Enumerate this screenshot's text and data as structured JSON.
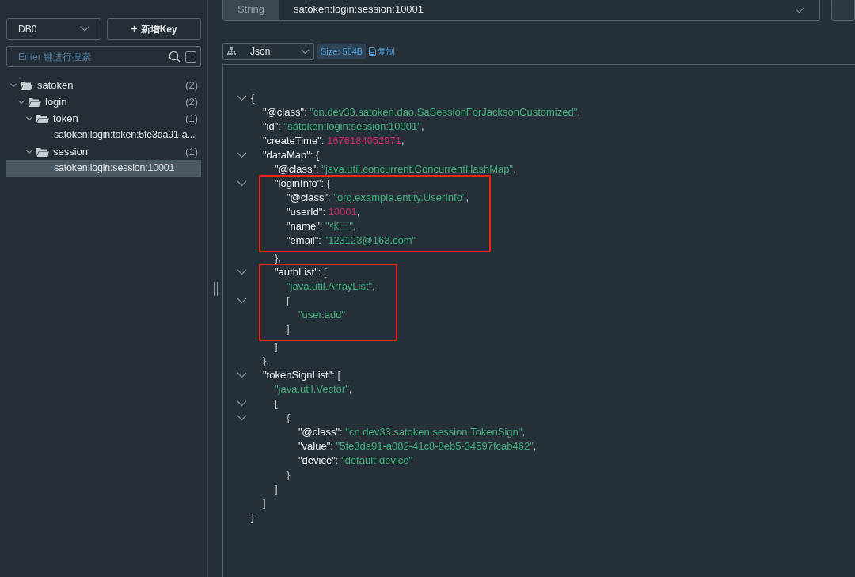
{
  "sidebar": {
    "db_select": {
      "value": "DB0"
    },
    "new_key_button": {
      "icon": "+",
      "label": "新增Key"
    },
    "search": {
      "placeholder": "Enter 键进行搜索",
      "exact_match_checked": false
    },
    "tree": [
      {
        "label": "satoken",
        "count": "(2)",
        "expanded": true,
        "selected": false,
        "children": [
          {
            "label": "login",
            "count": "(2)",
            "expanded": true,
            "selected": false,
            "children": [
              {
                "label": "token",
                "count": "(1)",
                "expanded": true,
                "selected": false,
                "children": [
                  {
                    "label": "satoken:login:token:5fe3da91-a...",
                    "selected": false
                  }
                ]
              },
              {
                "label": "session",
                "count": "(1)",
                "expanded": true,
                "selected": false,
                "children": [
                  {
                    "label": "satoken:login:session:10001",
                    "selected": true
                  }
                ]
              }
            ]
          }
        ]
      }
    ]
  },
  "key_bar": {
    "type": "String",
    "key": "satoken:login:session:10001"
  },
  "viewer": {
    "format": "Json",
    "size": "Size: 504B",
    "copy_label": "复制",
    "document": {
      "open": [
        {
          "kind": "punct",
          "text": "{"
        }
      ],
      "expanded": true,
      "close": [
        {
          "kind": "punct",
          "text": "}"
        }
      ],
      "children": [
        {
          "parts": [
            {
              "kind": "key",
              "text": "\"@class\""
            },
            {
              "kind": "punct",
              "text": ": "
            },
            {
              "kind": "string",
              "text": "\"cn.dev33.satoken.dao.SaSessionForJacksonCustomized\""
            },
            {
              "kind": "punct",
              "text": ","
            }
          ]
        },
        {
          "parts": [
            {
              "kind": "key",
              "text": "\"id\""
            },
            {
              "kind": "punct",
              "text": ": "
            },
            {
              "kind": "string",
              "text": "\"satoken:login:session:10001\""
            },
            {
              "kind": "punct",
              "text": ","
            }
          ]
        },
        {
          "parts": [
            {
              "kind": "key",
              "text": "\"createTime\""
            },
            {
              "kind": "punct",
              "text": ": "
            },
            {
              "kind": "number",
              "text": "1676184052971"
            },
            {
              "kind": "punct",
              "text": ","
            }
          ]
        },
        {
          "open": [
            {
              "kind": "key",
              "text": "\"dataMap\""
            },
            {
              "kind": "punct",
              "text": ": {"
            }
          ],
          "expanded": true,
          "close": [
            {
              "kind": "punct",
              "text": "},"
            }
          ],
          "children": [
            {
              "parts": [
                {
                  "kind": "key",
                  "text": "\"@class\""
                },
                {
                  "kind": "punct",
                  "text": ": "
                },
                {
                  "kind": "string",
                  "text": "\"java.util.concurrent.ConcurrentHashMap\""
                },
                {
                  "kind": "punct",
                  "text": ","
                }
              ]
            },
            {
              "open": [
                {
                  "kind": "key",
                  "text": "\"loginInfo\""
                },
                {
                  "kind": "punct",
                  "text": ": {"
                }
              ],
              "expanded": true,
              "highlighted": true,
              "close": [
                {
                  "kind": "punct",
                  "text": "},"
                }
              ],
              "children": [
                {
                  "parts": [
                    {
                      "kind": "key",
                      "text": "\"@class\""
                    },
                    {
                      "kind": "punct",
                      "text": ": "
                    },
                    {
                      "kind": "string",
                      "text": "\"org.example.entity.UserInfo\""
                    },
                    {
                      "kind": "punct",
                      "text": ","
                    }
                  ]
                },
                {
                  "parts": [
                    {
                      "kind": "key",
                      "text": "\"userId\""
                    },
                    {
                      "kind": "punct",
                      "text": ": "
                    },
                    {
                      "kind": "number",
                      "text": "10001"
                    },
                    {
                      "kind": "punct",
                      "text": ","
                    }
                  ]
                },
                {
                  "parts": [
                    {
                      "kind": "key",
                      "text": "\"name\""
                    },
                    {
                      "kind": "punct",
                      "text": ": "
                    },
                    {
                      "kind": "string",
                      "text": "\"张三\""
                    },
                    {
                      "kind": "punct",
                      "text": ","
                    }
                  ]
                },
                {
                  "parts": [
                    {
                      "kind": "key",
                      "text": "\"email\""
                    },
                    {
                      "kind": "punct",
                      "text": ": "
                    },
                    {
                      "kind": "string",
                      "text": "\"123123@163.com\""
                    }
                  ]
                }
              ]
            },
            {
              "open": [
                {
                  "kind": "key",
                  "text": "\"authList\""
                },
                {
                  "kind": "punct",
                  "text": ": ["
                }
              ],
              "expanded": true,
              "highlighted": true,
              "close": [
                {
                  "kind": "punct",
                  "text": "]"
                }
              ],
              "children": [
                {
                  "parts": [
                    {
                      "kind": "string",
                      "text": "\"java.util.ArrayList\""
                    },
                    {
                      "kind": "punct",
                      "text": ","
                    }
                  ]
                },
                {
                  "open": [
                    {
                      "kind": "punct",
                      "text": "["
                    }
                  ],
                  "expanded": true,
                  "close": [
                    {
                      "kind": "punct",
                      "text": "]"
                    }
                  ],
                  "children": [
                    {
                      "parts": [
                        {
                          "kind": "string",
                          "text": "\"user.add\""
                        }
                      ]
                    }
                  ]
                }
              ]
            }
          ]
        },
        {
          "open": [
            {
              "kind": "key",
              "text": "\"tokenSignList\""
            },
            {
              "kind": "punct",
              "text": ": ["
            }
          ],
          "expanded": true,
          "close": [
            {
              "kind": "punct",
              "text": "]"
            }
          ],
          "children": [
            {
              "parts": [
                {
                  "kind": "string",
                  "text": "\"java.util.Vector\""
                },
                {
                  "kind": "punct",
                  "text": ","
                }
              ]
            },
            {
              "open": [
                {
                  "kind": "punct",
                  "text": "["
                }
              ],
              "expanded": true,
              "close": [
                {
                  "kind": "punct",
                  "text": "]"
                }
              ],
              "children": [
                {
                  "open": [
                    {
                      "kind": "punct",
                      "text": "{"
                    }
                  ],
                  "expanded": true,
                  "close": [
                    {
                      "kind": "punct",
                      "text": "}"
                    }
                  ],
                  "children": [
                    {
                      "parts": [
                        {
                          "kind": "key",
                          "text": "\"@class\""
                        },
                        {
                          "kind": "punct",
                          "text": ": "
                        },
                        {
                          "kind": "string",
                          "text": "\"cn.dev33.satoken.session.TokenSign\""
                        },
                        {
                          "kind": "punct",
                          "text": ","
                        }
                      ]
                    },
                    {
                      "parts": [
                        {
                          "kind": "key",
                          "text": "\"value\""
                        },
                        {
                          "kind": "punct",
                          "text": ": "
                        },
                        {
                          "kind": "string",
                          "text": "\"5fe3da91-a082-41c8-8eb5-34597fcab462\""
                        },
                        {
                          "kind": "punct",
                          "text": ","
                        }
                      ]
                    },
                    {
                      "parts": [
                        {
                          "kind": "key",
                          "text": "\"device\""
                        },
                        {
                          "kind": "punct",
                          "text": ": "
                        },
                        {
                          "kind": "string",
                          "text": "\"default-device\""
                        }
                      ]
                    }
                  ]
                }
              ]
            }
          ]
        }
      ]
    }
  }
}
